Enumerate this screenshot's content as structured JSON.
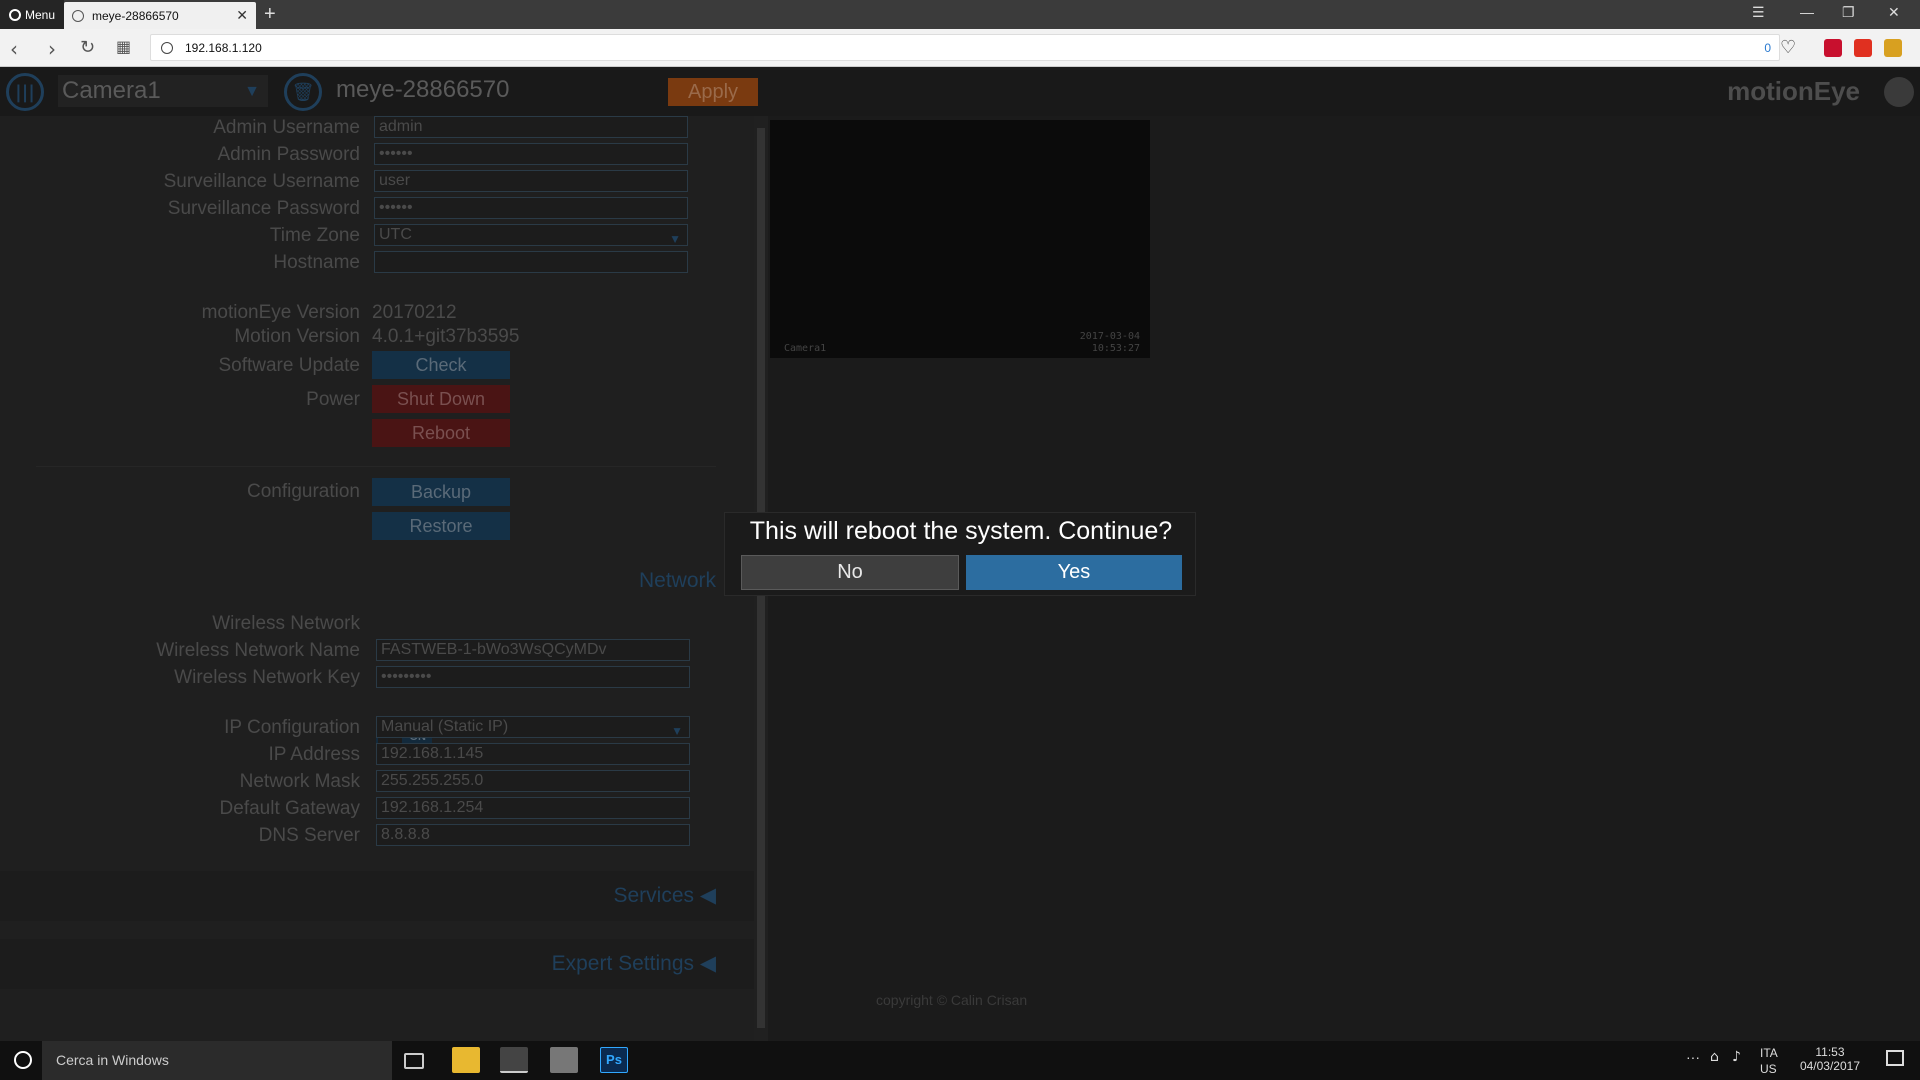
{
  "browser": {
    "menu_label": "Menu",
    "tab_title": "meye-28866570",
    "url": "192.168.1.120",
    "adblock_count": "0"
  },
  "header": {
    "camera_name": "Camera1",
    "device_title": "meye-28866570",
    "apply_label": "Apply",
    "brand": "motionEye"
  },
  "general": {
    "admin_username": {
      "label": "Admin Username",
      "value": "admin"
    },
    "admin_password": {
      "label": "Admin Password",
      "value": "••••••"
    },
    "surveillance_username": {
      "label": "Surveillance Username",
      "value": "user"
    },
    "surveillance_password": {
      "label": "Surveillance Password",
      "value": "••••••"
    },
    "time_zone": {
      "label": "Time Zone",
      "value": "UTC"
    },
    "hostname": {
      "label": "Hostname",
      "value": ""
    },
    "motioneye_version": {
      "label": "motionEye Version",
      "value": "20170212"
    },
    "motion_version": {
      "label": "Motion Version",
      "value": "4.0.1+git37b3595"
    },
    "software_update": {
      "label": "Software Update",
      "button": "Check"
    },
    "power": {
      "label": "Power",
      "shutdown": "Shut Down",
      "reboot": "Reboot"
    },
    "configuration": {
      "label": "Configuration",
      "backup": "Backup",
      "restore": "Restore"
    }
  },
  "network": {
    "section_title": "Network",
    "wireless_network": {
      "label": "Wireless Network",
      "toggle": "ON"
    },
    "wireless_name": {
      "label": "Wireless Network Name",
      "value": "FASTWEB-1-bWo3WsQCyMDv"
    },
    "wireless_key": {
      "label": "Wireless Network Key",
      "value": "•••••••••"
    },
    "ip_configuration": {
      "label": "IP Configuration",
      "value": "Manual (Static IP)"
    },
    "ip_address": {
      "label": "IP Address",
      "value": "192.168.1.145"
    },
    "network_mask": {
      "label": "Network Mask",
      "value": "255.255.255.0"
    },
    "default_gateway": {
      "label": "Default Gateway",
      "value": "192.168.1.254"
    },
    "dns_server": {
      "label": "DNS Server",
      "value": "8.8.8.8"
    }
  },
  "sections": {
    "services": "Services",
    "expert_settings": "Expert Settings"
  },
  "camera_view": {
    "osd_name": "Camera1",
    "osd_date": "2017-03-04",
    "osd_time": "10:53:27"
  },
  "footer": {
    "copyright": "copyright © Calin Crisan"
  },
  "dialog": {
    "message": "This will reboot the system. Continue?",
    "no_label": "No",
    "yes_label": "Yes"
  },
  "taskbar": {
    "search_placeholder": "Cerca in Windows",
    "lang_top": "ITA",
    "lang_bottom": "US",
    "time": "11:53",
    "date": "04/03/2017"
  },
  "colors": {
    "dialog_yes": "#2c6da0",
    "apply": "#7a3a10",
    "accent_blue": "#1f3f5b"
  }
}
